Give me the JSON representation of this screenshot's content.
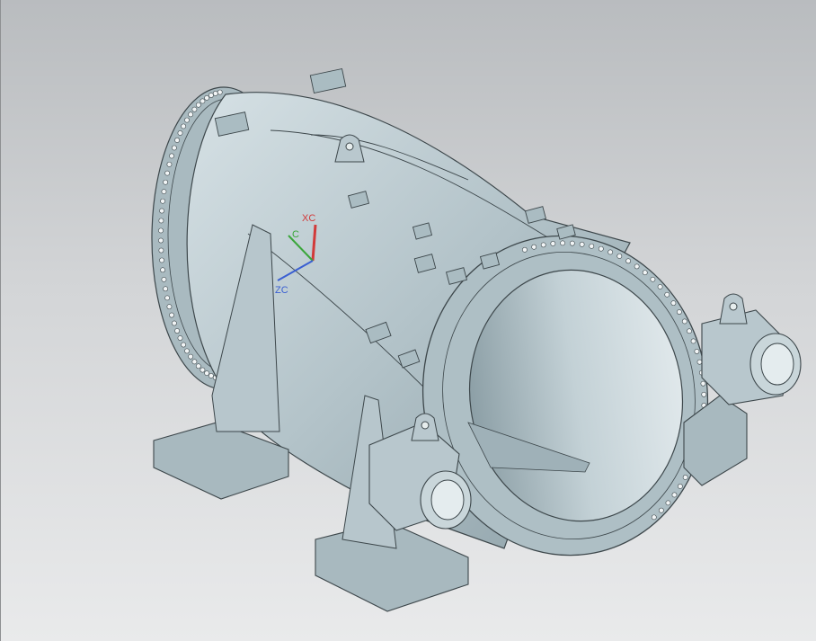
{
  "viewport": {
    "background_top": "#b9bcbf",
    "background_bottom": "#e9eaeb"
  },
  "model": {
    "body_color": "#b4c4ca",
    "edge_color": "#3d474b",
    "shadow_color": "#8fa2a9",
    "highlight_color": "#d8e3e7"
  },
  "triad": {
    "xc_label": "XC",
    "yc_label": "C",
    "zc_label": "ZC",
    "xc_color": "#d23a3a",
    "yc_color": "#3aa63a",
    "zc_color": "#3a5fd2"
  }
}
